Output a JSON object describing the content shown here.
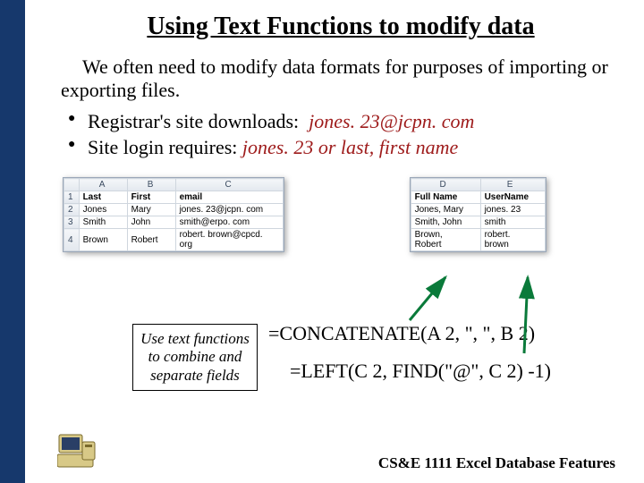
{
  "title": "Using Text Functions to modify data",
  "intro": "We often need to modify data formats for purposes of importing or exporting files.",
  "bullets": [
    {
      "prefix": "Registrar's site downloads:",
      "emph": "jones. 23@jcpn. com"
    },
    {
      "prefix": "Site login requires:",
      "emph": "jones. 23 or last, first name"
    }
  ],
  "left_table": {
    "columns": [
      "",
      "A",
      "B",
      "C"
    ],
    "rows": [
      {
        "n": "1",
        "cells": [
          "Last",
          "First",
          "email"
        ],
        "bold": true
      },
      {
        "n": "2",
        "cells": [
          "Jones",
          "Mary",
          "jones. 23@jcpn. com"
        ],
        "bold": false
      },
      {
        "n": "3",
        "cells": [
          "Smith",
          "John",
          "smith@erpo. com"
        ],
        "bold": false
      },
      {
        "n": "4",
        "cells": [
          "Brown",
          "Robert",
          "robert. brown@cpcd. org"
        ],
        "bold": false
      }
    ]
  },
  "right_table": {
    "columns": [
      "D",
      "E"
    ],
    "rows": [
      {
        "cells": [
          "Full Name",
          "UserName"
        ],
        "bold": true
      },
      {
        "cells": [
          "Jones, Mary",
          "jones. 23"
        ],
        "bold": false
      },
      {
        "cells": [
          "Smith, John",
          "smith"
        ],
        "bold": false
      },
      {
        "cells": [
          "Brown, Robert",
          "robert. brown"
        ],
        "bold": false
      }
    ]
  },
  "formula_box": "Use text functions to combine and separate fields",
  "formula1": "=CONCATENATE(A 2, \", \", B 2)",
  "formula2": "=LEFT(C 2, FIND(\"@\", C 2) -1)",
  "footer": "CS&E 1111 Excel Database Features",
  "colors": {
    "accent_dark": "#16386c",
    "emph_red": "#9e1b1b",
    "arrow_green": "#0a7a3a"
  }
}
